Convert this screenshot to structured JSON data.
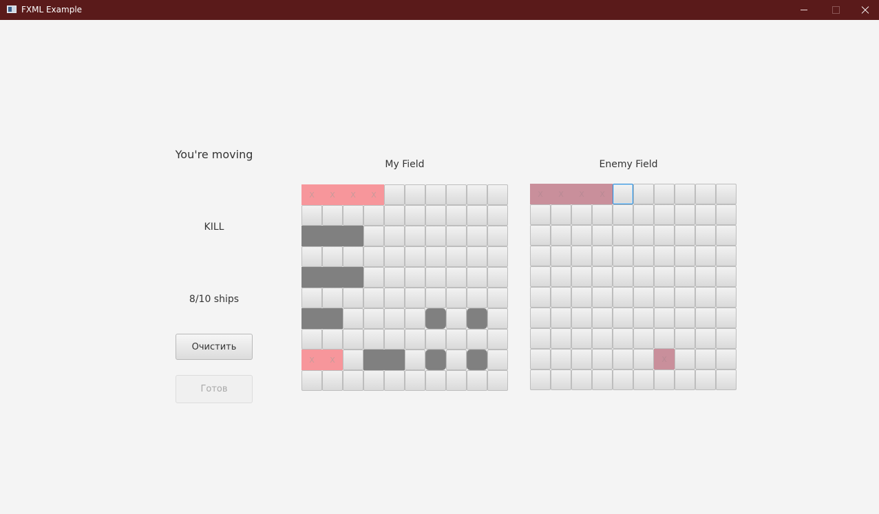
{
  "window": {
    "title": "FXML Example"
  },
  "status": {
    "turn": "You're moving",
    "result": "KILL",
    "ships": "8/10 ships"
  },
  "buttons": {
    "clear": "Очистить",
    "ready": "Готов"
  },
  "my_field": {
    "title": "My Field",
    "cells": [
      "XXXX......",
      "..........",
      "SSS.......",
      "..........",
      "SSS.......",
      "..........",
      "SS....o.o.",
      "..........",
      "XX.SS.o.o.",
      ".........."
    ]
  },
  "enemy_field": {
    "title": "Enemy Field",
    "cells": [
      "XXXXF.....",
      "..........",
      "..........",
      "..........",
      "..........",
      "..........",
      "..........",
      "..........",
      "......X...",
      ".........."
    ]
  },
  "legend": {
    "hit_mark": "X",
    "colors": {
      "my_hit": "#f7969b",
      "ship": "#808080",
      "enemy_hit": "#c98f9b",
      "title_bar": "#5a1a1a"
    }
  }
}
